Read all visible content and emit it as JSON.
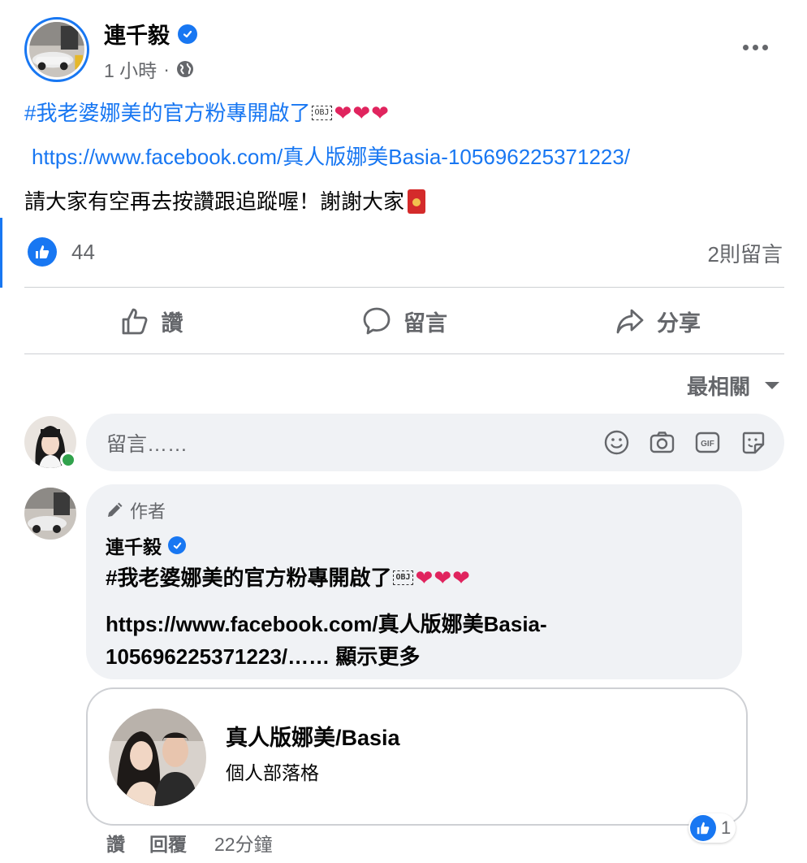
{
  "post": {
    "author": "連千毅",
    "time": "1 小時",
    "separator": "·",
    "hashtag_line": "#我老婆娜美的官方粉專開啟了",
    "obj_glyph": "OBJ",
    "hearts": [
      "❤",
      "❤",
      "❤"
    ],
    "link": "https://www.facebook.com/真人版娜美Basia-105696225371223/",
    "text_line3": "請大家有空再去按讚跟追蹤喔！謝謝大家"
  },
  "stats": {
    "likes": "44",
    "comments": "2則留言"
  },
  "actions": {
    "like": "讚",
    "comment": "留言",
    "share": "分享"
  },
  "sort_label": "最相關",
  "comment_input": {
    "placeholder": "留言……"
  },
  "comment": {
    "author_tag": "作者",
    "name": "連千毅",
    "text": "#我老婆娜美的官方粉專開啟了",
    "obj_glyph": "OBJ",
    "hearts": [
      "❤",
      "❤",
      "❤"
    ],
    "link_line1": "https://www.facebook.com/真人版娜美Basia-",
    "link_line2": "105696225371223/……",
    "see_more": "顯示更多",
    "preview": {
      "title": "真人版娜美/Basia",
      "subtitle": "個人部落格"
    },
    "reactions": "1",
    "like_label": "讚",
    "reply_label": "回覆",
    "time": "22分鐘"
  },
  "colors": {
    "accent": "#1877f2",
    "secondary_text": "#65676b",
    "bubble_bg": "#f0f2f5",
    "online": "#31a24c",
    "heart": "#e0245e"
  },
  "icons": [
    "verified-icon",
    "globe-icon",
    "more-icon",
    "like-icon",
    "comment-icon",
    "share-icon",
    "emoji-icon",
    "camera-icon",
    "gif-icon",
    "sticker-icon",
    "pencil-icon",
    "caret-down-icon"
  ]
}
